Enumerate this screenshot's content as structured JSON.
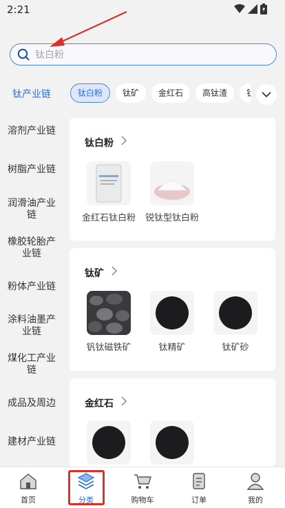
{
  "status_bar": {
    "time": "2:21"
  },
  "search": {
    "placeholder": "钛白粉"
  },
  "category_bar": {
    "title": "钛产业链",
    "chips": [
      {
        "label": "钛白粉",
        "active": true
      },
      {
        "label": "钛矿",
        "active": false
      },
      {
        "label": "金红石",
        "active": false
      },
      {
        "label": "高钛渣",
        "active": false
      },
      {
        "label": "钛",
        "active": false
      }
    ]
  },
  "sidebar": {
    "items": [
      {
        "label": "溶剂产业链"
      },
      {
        "label": "树脂产业链"
      },
      {
        "label": "润滑油产业链"
      },
      {
        "label": "橡胶轮胎产业链"
      },
      {
        "label": "粉体产业链"
      },
      {
        "label": "涂料油墨产业链"
      },
      {
        "label": "煤化工产业链"
      },
      {
        "label": "成品及周边"
      },
      {
        "label": "建材产业链"
      }
    ]
  },
  "sections": [
    {
      "title": "钛白粉",
      "products": [
        {
          "label": "金红石钛白粉",
          "image": "bag"
        },
        {
          "label": "锐钛型钛白粉",
          "image": "powder"
        }
      ]
    },
    {
      "title": "钛矿",
      "products": [
        {
          "label": "钒钛磁铁矿",
          "image": "ore"
        },
        {
          "label": "钛精矿",
          "image": "black-sand"
        },
        {
          "label": "钛矿砂",
          "image": "black-sand"
        }
      ]
    },
    {
      "title": "金红石",
      "products": [
        {
          "label": "",
          "image": "black-sand"
        },
        {
          "label": "",
          "image": "black-sand"
        }
      ]
    }
  ],
  "tab_bar": {
    "tabs": [
      {
        "label": "首页",
        "active": false
      },
      {
        "label": "分类",
        "active": true
      },
      {
        "label": "购物车",
        "active": false
      },
      {
        "label": "订单",
        "active": false
      },
      {
        "label": "我的",
        "active": false
      }
    ]
  },
  "colors": {
    "accent": "#2a6fd6",
    "annotation": "#d9302a"
  }
}
